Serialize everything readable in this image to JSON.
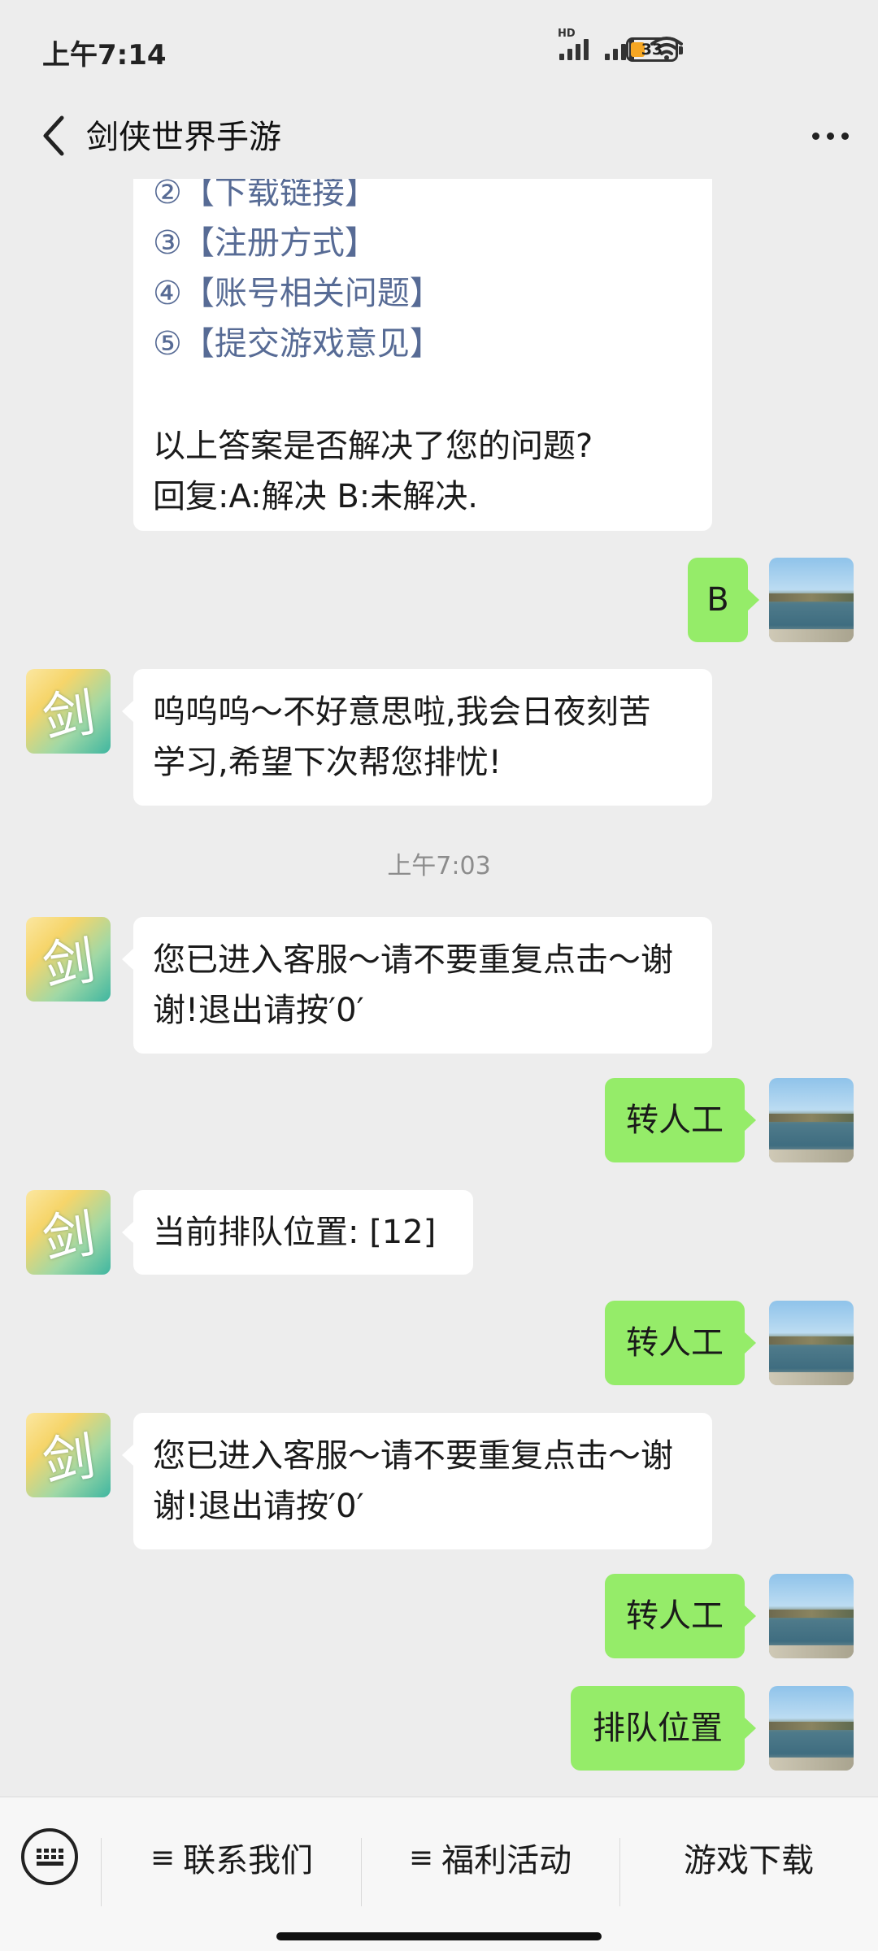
{
  "status_bar": {
    "time": "上午7:14",
    "network_label": "HD",
    "battery_level": "33",
    "battery_fraction": 0.33,
    "icons": [
      "hd-signal-icon",
      "signal-icon",
      "wifi-icon",
      "battery-icon"
    ]
  },
  "header": {
    "title": "剑侠世界手游",
    "back_icon": "chevron-left-icon",
    "more_icon": "more-dots-icon"
  },
  "messages": {
    "m1": {
      "sender": "bot",
      "partial_line": "②【下载链接】",
      "links": [
        "③【注册方式】",
        "④【账号相关问题】",
        "⑤【提交游戏意见】"
      ],
      "question": "以上答案是否解决了您的问题?",
      "options": "回复:A:解决   B:未解决."
    },
    "m2": {
      "sender": "user",
      "text": "B"
    },
    "m3": {
      "sender": "bot",
      "lines": [
        "呜呜呜～不好意思啦,我会日夜刻苦",
        "学习,希望下次帮您排忧!"
      ]
    },
    "timestamp": "上午7:03",
    "m4": {
      "sender": "bot",
      "lines": [
        "您已进入客服～请不要重复点击～谢",
        "谢!退出请按′0′"
      ]
    },
    "m5": {
      "sender": "user",
      "text": "转人工"
    },
    "m6": {
      "sender": "bot",
      "text": "当前排队位置: [12]"
    },
    "m7": {
      "sender": "user",
      "text": "转人工"
    },
    "m8": {
      "sender": "bot",
      "lines": [
        "您已进入客服～请不要重复点击～谢",
        "谢!退出请按′0′"
      ]
    },
    "m9": {
      "sender": "user",
      "text": "转人工"
    },
    "m10": {
      "sender": "user",
      "text": "排队位置"
    }
  },
  "avatars": {
    "bot_glyph": "剑"
  },
  "bottom_menu": {
    "keyboard_icon": "keyboard-icon",
    "menu_glyph": "≡",
    "contact": "联系我们",
    "welfare": "福利活动",
    "download": "游戏下载"
  },
  "colors": {
    "background": "#ededed",
    "user_bubble": "#95ec69",
    "bot_bubble": "#ffffff",
    "link": "#576b95",
    "timestamp": "#8c8c8c"
  }
}
